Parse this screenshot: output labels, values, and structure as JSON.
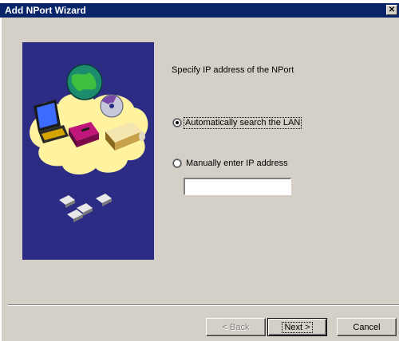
{
  "window": {
    "title": "Add NPort Wizard",
    "close_glyph": "✕",
    "titlebar_color": "#0a246a"
  },
  "content": {
    "prompt": "Specify IP address of the NPort",
    "options": [
      {
        "label": "Automatically search the LAN",
        "selected": true
      },
      {
        "label": "Manually enter IP address",
        "selected": false
      }
    ],
    "ip_field": {
      "value": "",
      "placeholder": ""
    }
  },
  "illustration": {
    "description_icons": [
      "computer-icon",
      "globe-icon",
      "cd-icon",
      "printer-icon",
      "drive-icon",
      "disk-icon"
    ],
    "background_color": "#2c2c84",
    "highlight_color": "#fff3a0"
  },
  "buttons": {
    "back": "< Back",
    "next": "Next >",
    "cancel": "Cancel"
  }
}
